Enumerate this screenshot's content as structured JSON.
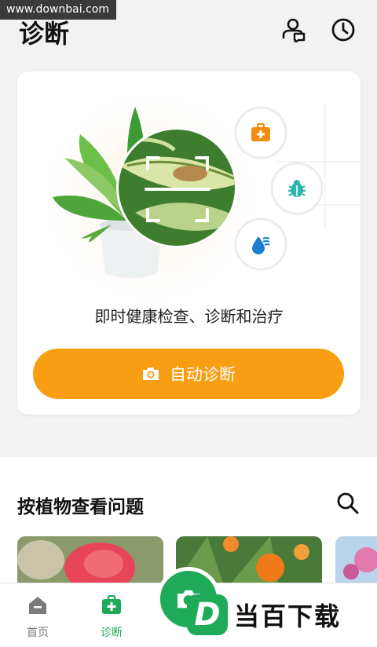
{
  "watermark": "www.downbai.com",
  "header": {
    "title": "诊断",
    "icons": [
      "expert-chat-icon",
      "history-clock-icon"
    ]
  },
  "card": {
    "description": "即时健康检查、诊断和治疗",
    "cta_label": "自动诊断",
    "badges": [
      "first-aid-kit-icon",
      "bug-icon",
      "water-drop-icon"
    ]
  },
  "section": {
    "title": "按植物查看问题",
    "thumbnails": [
      "rose-thumbnail",
      "lily-thumbnail",
      "flower-thumbnail"
    ]
  },
  "tabbar": {
    "home_label": "首页",
    "diagnose_label": "诊断"
  },
  "brand": {
    "logo_letter": "D",
    "name": "当百下载"
  },
  "colors": {
    "accent": "#f99d12",
    "green": "#1faa59",
    "inactive": "#7a7a7a"
  }
}
